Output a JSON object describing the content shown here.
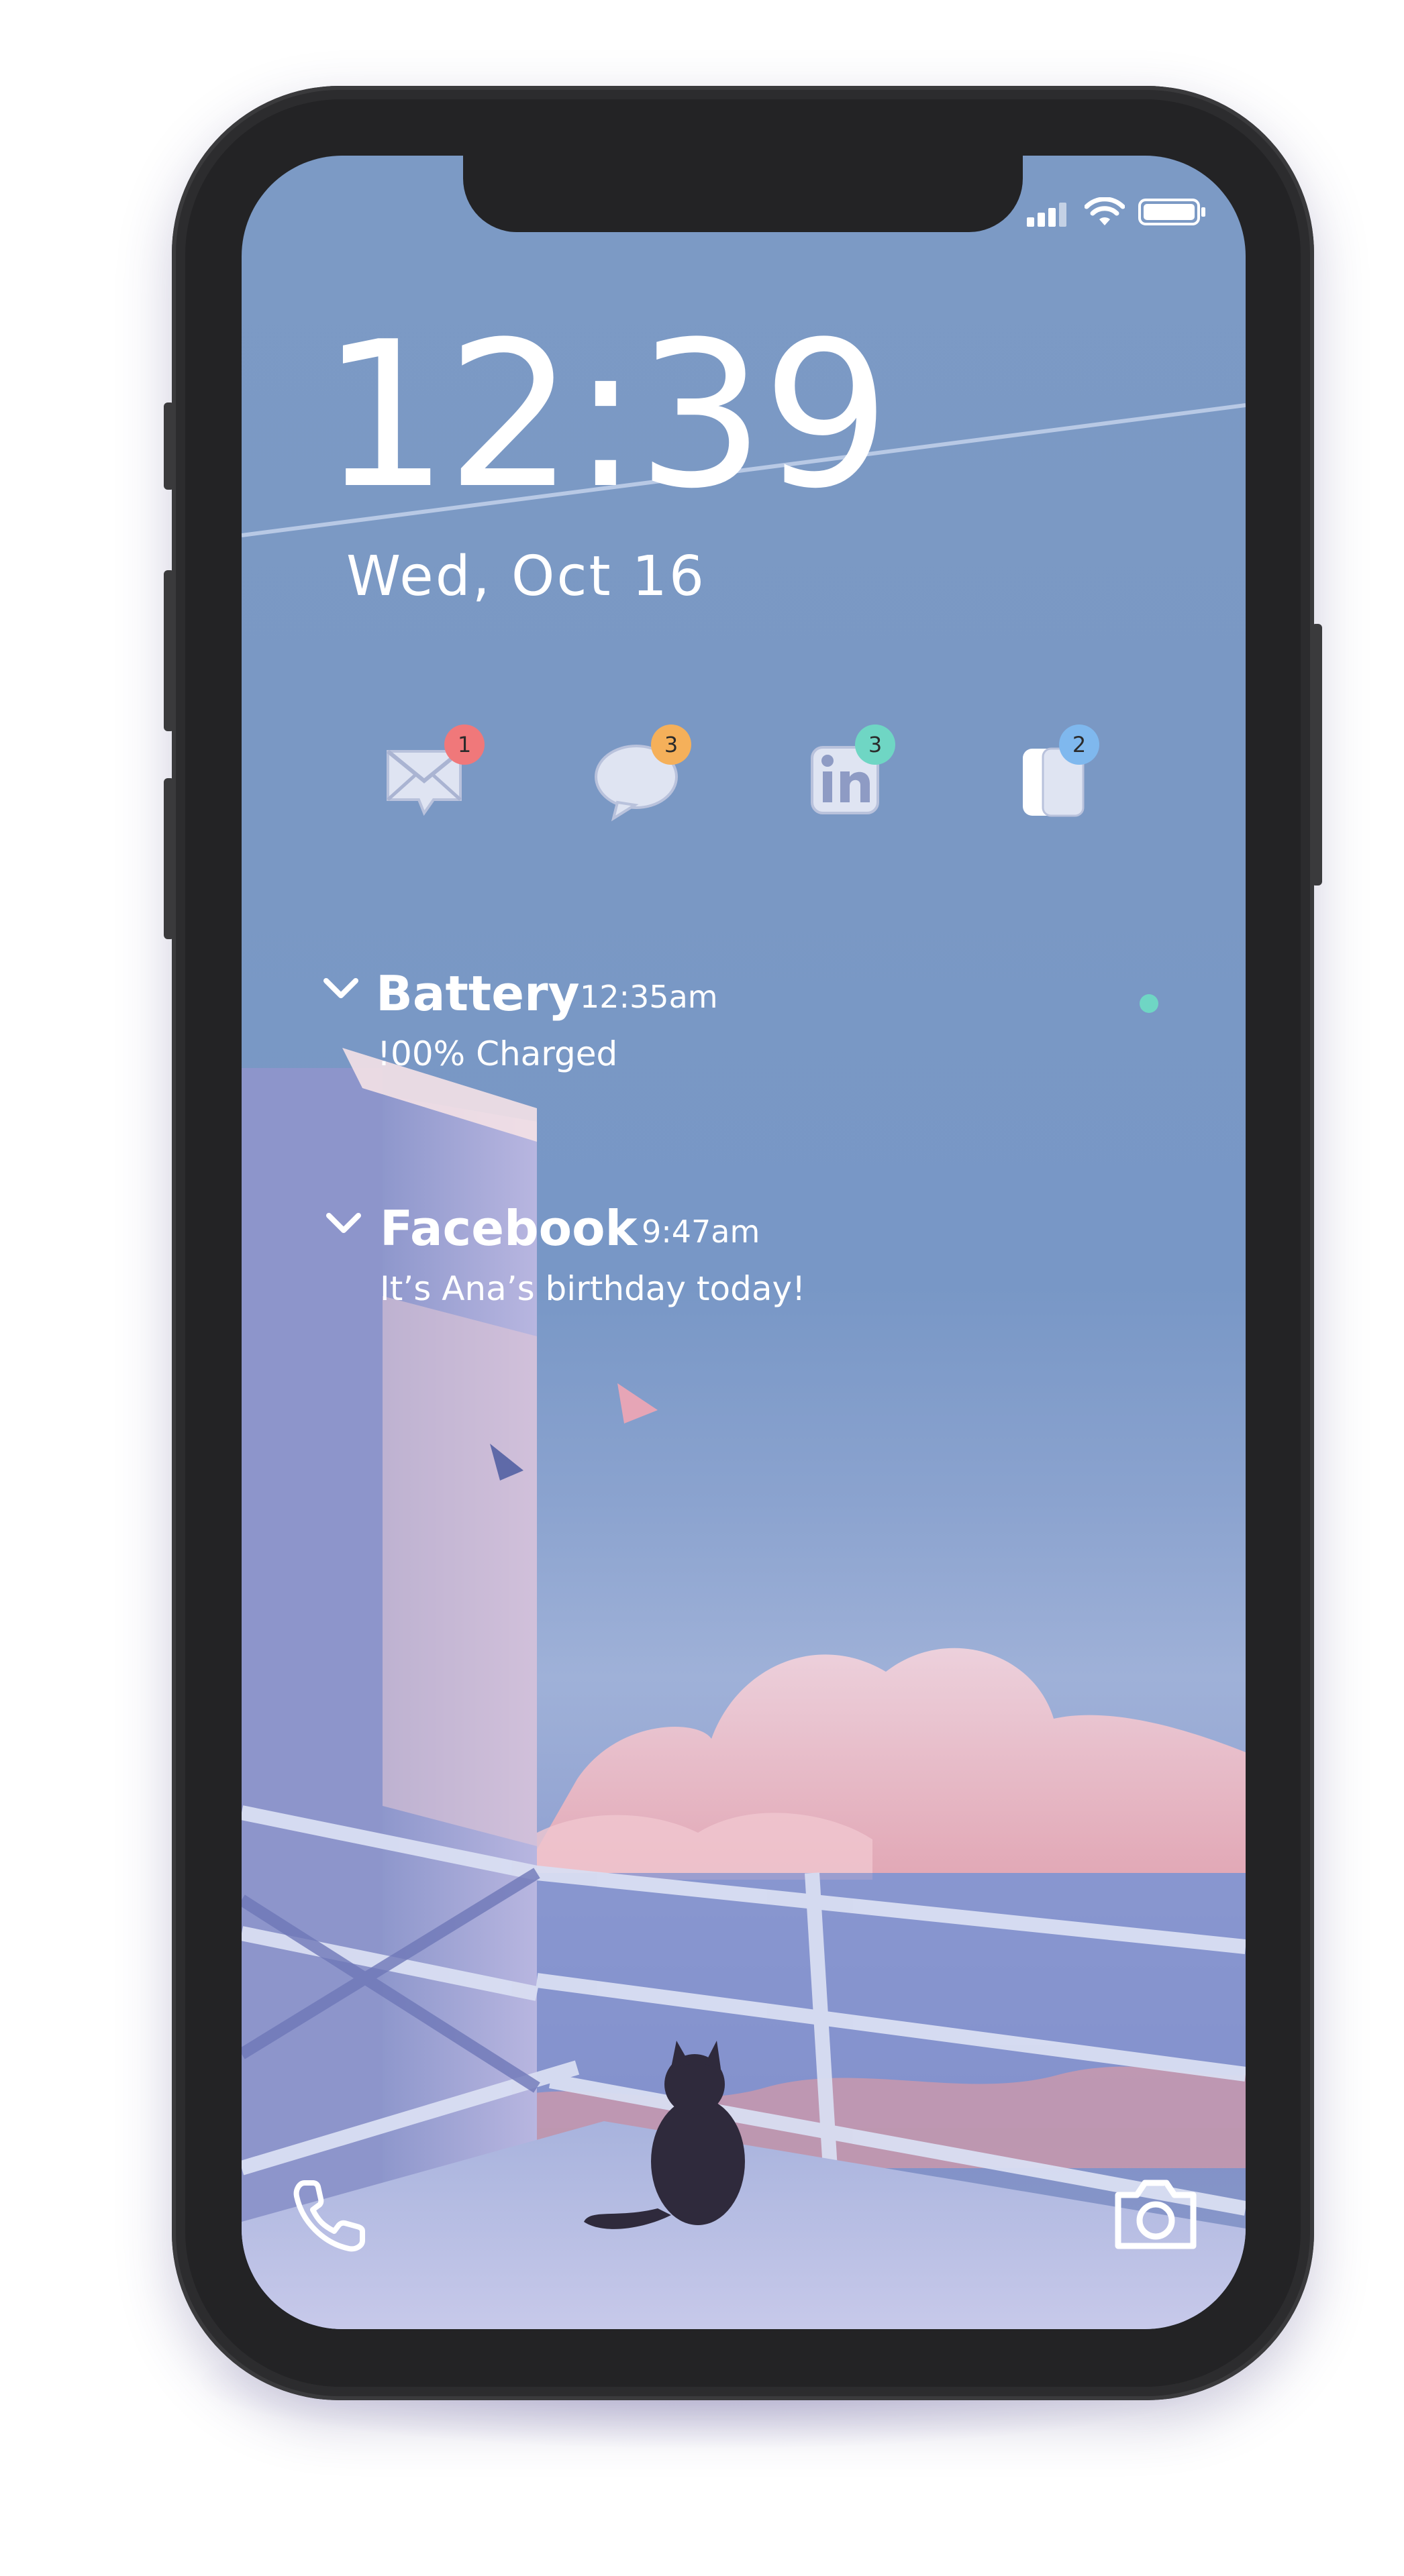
{
  "lock_screen": {
    "time": "12:39",
    "date": "Wed, Oct 16"
  },
  "status_bar": {
    "icons": [
      "signal-icon",
      "wifi-icon",
      "battery-icon"
    ]
  },
  "app_badges": [
    {
      "icon": "mail-icon",
      "count": "1",
      "color": "#f0787a"
    },
    {
      "icon": "chat-icon",
      "count": "3",
      "color": "#f5b05a"
    },
    {
      "icon": "linkedin-icon",
      "count": "3",
      "color": "#6fd6c4"
    },
    {
      "icon": "app-icon",
      "count": "2",
      "color": "#7fb8ee"
    }
  ],
  "notifications": [
    {
      "app": "Battery",
      "time": "12:35am",
      "body": "!00% Charged"
    },
    {
      "app": "Facebook",
      "time": "9:47am",
      "body": "It’s Ana’s birthday today!"
    }
  ],
  "quick_actions": {
    "left": "phone-icon",
    "right": "camera-icon"
  },
  "colors": {
    "unread_dot": "#6fd6c4",
    "sky": "#7a98c4"
  }
}
